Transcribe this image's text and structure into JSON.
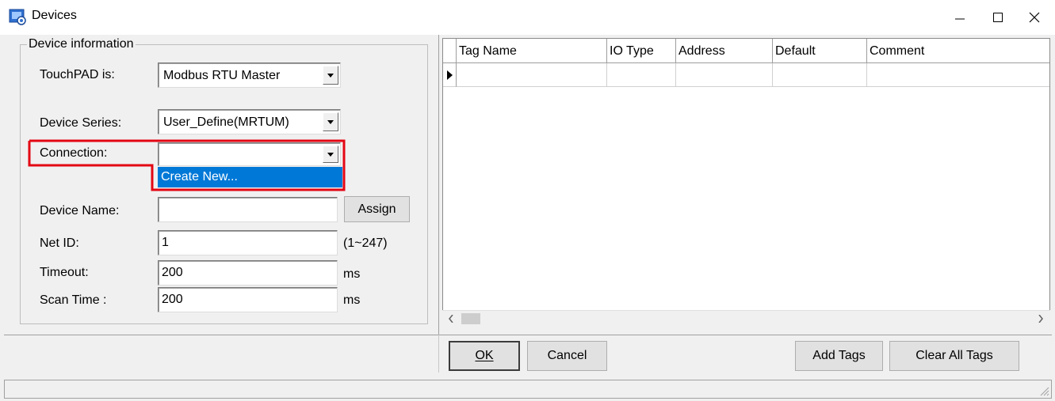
{
  "window": {
    "title": "Devices",
    "icon": "devices-app-icon"
  },
  "group": {
    "legend": "Device information",
    "touchpad": {
      "label": "TouchPAD is:",
      "value": "Modbus RTU Master"
    },
    "series": {
      "label": "Device Series:",
      "value": "User_Define(MRTUM)"
    },
    "connection": {
      "label": "Connection:",
      "value": "",
      "dropdown_option": "Create New..."
    },
    "device_name": {
      "label": "Device Name:",
      "value": "",
      "assign_button": "Assign"
    },
    "net_id": {
      "label": "Net ID:",
      "value": "1",
      "hint": "(1~247)"
    },
    "timeout": {
      "label": "Timeout:",
      "value": "200",
      "unit": "ms"
    },
    "scan_time": {
      "label": "Scan Time :",
      "value": "200",
      "unit": "ms"
    }
  },
  "grid": {
    "columns": [
      "Tag Name",
      "IO Type",
      "Address",
      "Default",
      "Comment"
    ]
  },
  "buttons": {
    "ok": "OK",
    "cancel": "Cancel",
    "add_tags": "Add Tags",
    "clear_all_tags": "Clear All Tags"
  },
  "colors": {
    "highlight_box": "#e30613",
    "selection": "#0078d7"
  }
}
